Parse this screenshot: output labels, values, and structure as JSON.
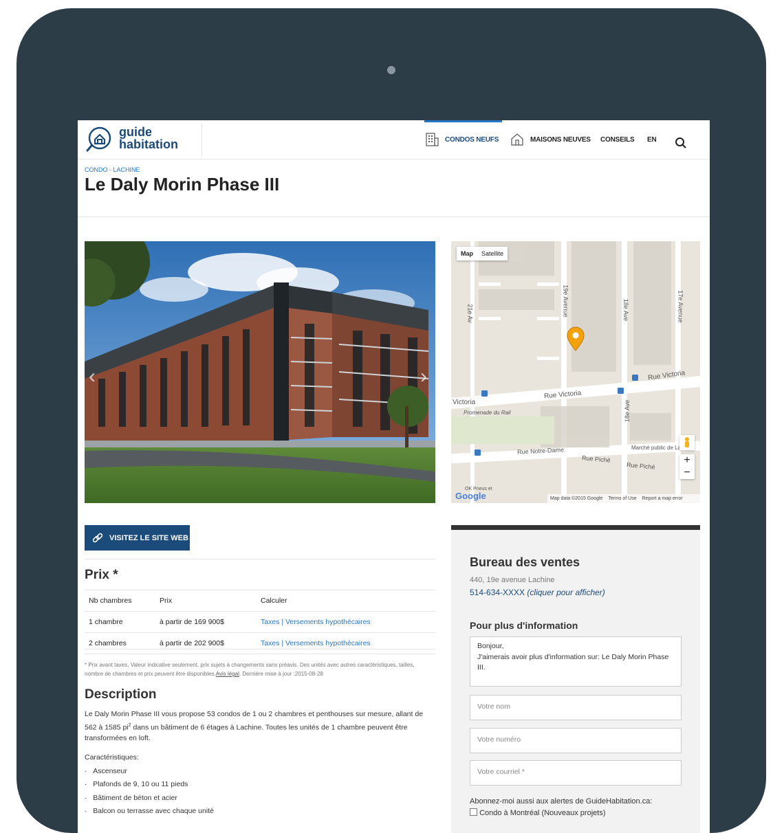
{
  "nav": {
    "logo_line1": "guide",
    "logo_line2": "habitation",
    "items": [
      "CONDOS NEUFS",
      "MAISONS NEUVES",
      "CONSEILS",
      "EN"
    ],
    "search_icon": "search-icon"
  },
  "page": {
    "breadcrumb": "CONDO - LACHINE",
    "title": "Le Daly Morin Phase III"
  },
  "map": {
    "tabs": [
      "Map",
      "Satellite"
    ],
    "labels": {
      "rue_victoria": "Rue Victoria",
      "victoria_left": "Victoria",
      "promenade": "Promenade du Rail",
      "notre_dame": "Rue Notre-Dame",
      "rue_piche1": "Rue Piché",
      "rue_piche2": "Rue Piché",
      "marche": "Marché public de Lachine",
      "ave21": "21e Av",
      "ave19": "19e Avenue",
      "ave18": "18e Ave",
      "ave17": "17e Avenue",
      "ave18b": "18e Ave",
      "ok_pneus": "OK Pneus et",
      "google": "Google"
    },
    "footer": [
      "Map data ©2015 Google",
      "Terms of Use",
      "Report a map error"
    ]
  },
  "visit_button": "VISITEZ LE SITE WEB",
  "prix": {
    "heading": "Prix *",
    "headers": [
      "Nb chambres",
      "Prix",
      "Calculer"
    ],
    "rows": [
      {
        "chambres": "1 chambre",
        "prix": "à partir de 169 900$",
        "calculer": "Taxes | Versements hypothécaires"
      },
      {
        "chambres": "2 chambres",
        "prix": "à partir de 202 900$",
        "calculer": "Taxes | Versements hypothécaires"
      }
    ],
    "footnote": "* Prix avant taxes. Valeur indicative seulement, prix sujets à changements sans préavis. Des unités avec autres caractéristiques, tailles, nombre de chambres et prix peuvent être disponibles.",
    "footnote_link": "Avis légal",
    "footnote_date": ". Dernière mise à jour :2015-08-28"
  },
  "description": {
    "heading": "Description",
    "text_a": "Le Daly Morin Phase III vous propose 53 condos de 1 ou 2 chambres et penthouses sur mesure, allant de 562 à 1585 pi",
    "text_sup": "2",
    "text_b": " dans un bâtiment de 6 étages à Lachine. Toutes les unités de 1 chambre peuvent être transformées en loft.",
    "features_label": "Caractéristiques:",
    "features": [
      "Ascenseur",
      "Plafonds de 9, 10 ou 11 pieds",
      "Bâtiment de béton et acier",
      "Balcon ou terrasse avec chaque unité"
    ]
  },
  "sales": {
    "heading": "Bureau des ventes",
    "address": "440, 19e avenue Lachine",
    "phone": "514-634-XXXX",
    "phone_link": "(cliquer pour afficher)",
    "info_heading": "Pour plus d'information",
    "message": "Bonjour,\nJ'aimerais avoir plus d'information sur: Le Daly Morin Phase III.",
    "name_placeholder": "Votre nom",
    "number_placeholder": "Votre numéro",
    "email_placeholder": "Votre courriel *",
    "subscribe": "Abonnez-moi aussi aux alertes de GuideHabitation.ca:",
    "checkbox_label": "Condo à Montréal (Nouveaux projets)"
  }
}
